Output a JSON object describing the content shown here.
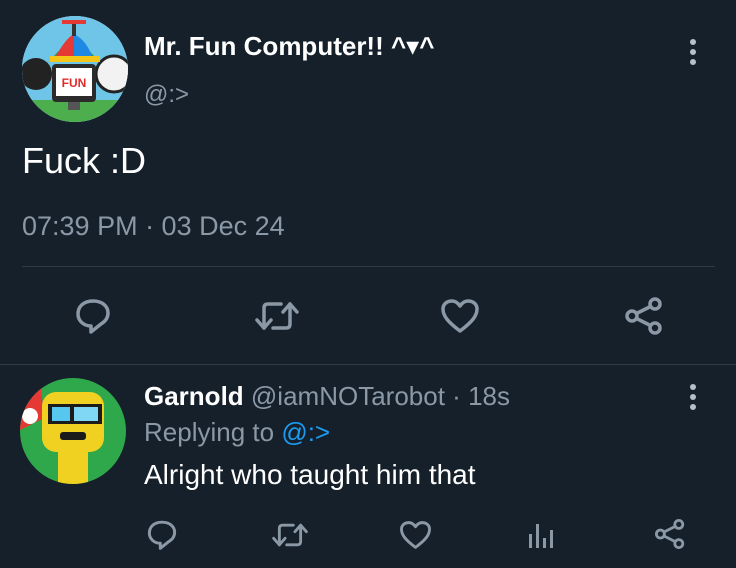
{
  "main_tweet": {
    "display_name": "Mr. Fun Computer!! ^▾^",
    "handle": "@:>",
    "text": "Fuck :D",
    "timestamp": "07:39 PM · 03 Dec 24",
    "avatar_label": "FUN"
  },
  "reply_tweet": {
    "display_name": "Garnold",
    "handle": "@iamNOTarobot",
    "separator": "·",
    "time_ago": "18s",
    "replying_prefix": "Replying to",
    "replying_handle": "@:>",
    "text": "Alright who taught him that"
  },
  "icons": {
    "reply": "comment-icon",
    "retweet": "retweet-icon",
    "like": "heart-icon",
    "share": "share-icon",
    "analytics": "analytics-icon",
    "more": "more-vertical-icon"
  },
  "colors": {
    "background": "#15202b",
    "text": "#ffffff",
    "muted": "#8b98a5",
    "link": "#1d9bf0",
    "icon": "#8b98a5",
    "divider": "#2f3b47"
  }
}
